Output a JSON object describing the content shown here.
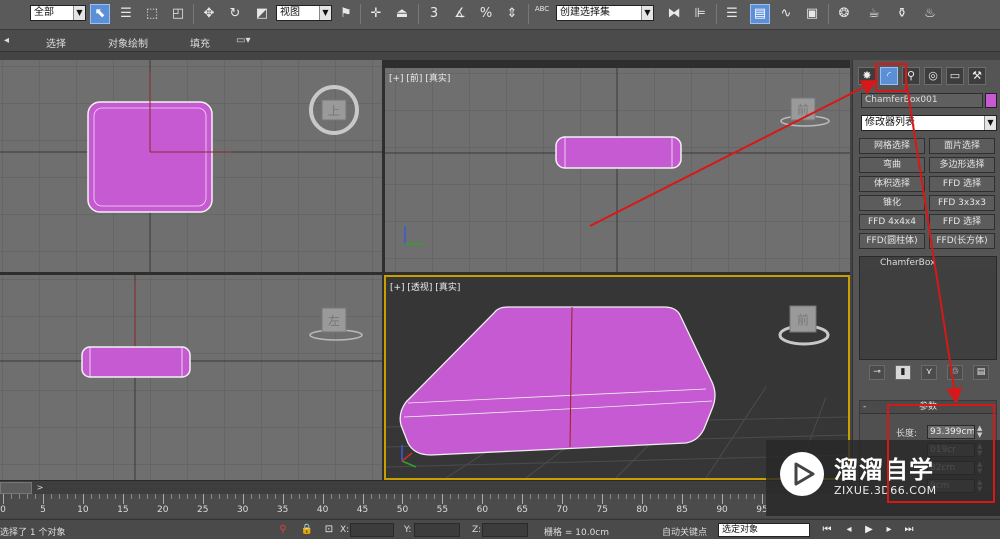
{
  "toolbar": {
    "selection_filter": "全部",
    "ref_coord": "视图",
    "named_selection": "创建选择集",
    "snap_number": "3",
    "percent_snap": "%",
    "abc_label": "ABC",
    "icons": [
      "select-object-icon",
      "select-by-name-icon",
      "rect-region-icon",
      "window-crossing-icon",
      "move-icon",
      "rotate-icon",
      "scale-icon",
      "link-icon",
      "snap-icon",
      "angle-snap-icon",
      "percent-snap-icon",
      "spinner-snap-icon",
      "edit-named-sel-icon",
      "mirror-icon",
      "align-icon",
      "layer-icon",
      "graphite-icon",
      "curve-editor-icon",
      "schematic-icon",
      "material-editor-icon",
      "render-setup-icon",
      "render-icon",
      "teapot-icon"
    ]
  },
  "ribbon": {
    "tabs": [
      "选择",
      "对象绘制",
      "填充"
    ]
  },
  "viewports": {
    "front_label": "[+] [前] [真实]",
    "persp_label": "[+] [透视] [真实]",
    "cube_top": "上",
    "cube_front": "前",
    "cube_left": "左",
    "cube_persp": "前",
    "object_color": "#c65ad2"
  },
  "command_panel": {
    "tabs": [
      "create-icon",
      "modify-icon",
      "hierarchy-icon",
      "motion-icon",
      "display-icon",
      "utilities-icon"
    ],
    "object_name": "ChamferBox001",
    "object_color": "#c65ad2",
    "modifier_list": "修改器列表",
    "modifier_buttons": [
      "网格选择",
      "面片选择",
      "弯曲",
      "多边形选择",
      "体积选择",
      "FFD 选择",
      "锥化",
      "FFD 3x3x3",
      "FFD 4x4x4",
      "FFD 选择",
      "FFD(圆柱体)",
      "FFD(长方体)"
    ],
    "stack_item": "ChamferBox",
    "rollout_title": "参数",
    "params": [
      {
        "label": "长度:",
        "value": "93.399cm"
      },
      {
        "label": "",
        "value": "019cr"
      },
      {
        "label": "",
        "value": "82cm"
      },
      {
        "label": "",
        "value": "9cm"
      }
    ]
  },
  "timeslider": {
    "position": "0 / 100",
    "next": ">"
  },
  "track": {
    "labels": [
      "0",
      "5",
      "10",
      "15",
      "20",
      "25",
      "30",
      "35",
      "40",
      "45",
      "50",
      "55",
      "60",
      "65",
      "70",
      "75",
      "80",
      "85",
      "90",
      "95"
    ]
  },
  "status": {
    "selection": "选择了 1 个对象",
    "x_label": "X:",
    "y_label": "Y:",
    "z_label": "Z:",
    "grid": "栅格 = 10.0cm",
    "auto_key": "自动关键点",
    "key_mode": "选定对象"
  },
  "watermark": {
    "title": "溜溜自学",
    "url": "ZIXUE.3D66.COM"
  },
  "annotation_color": "#d81818"
}
